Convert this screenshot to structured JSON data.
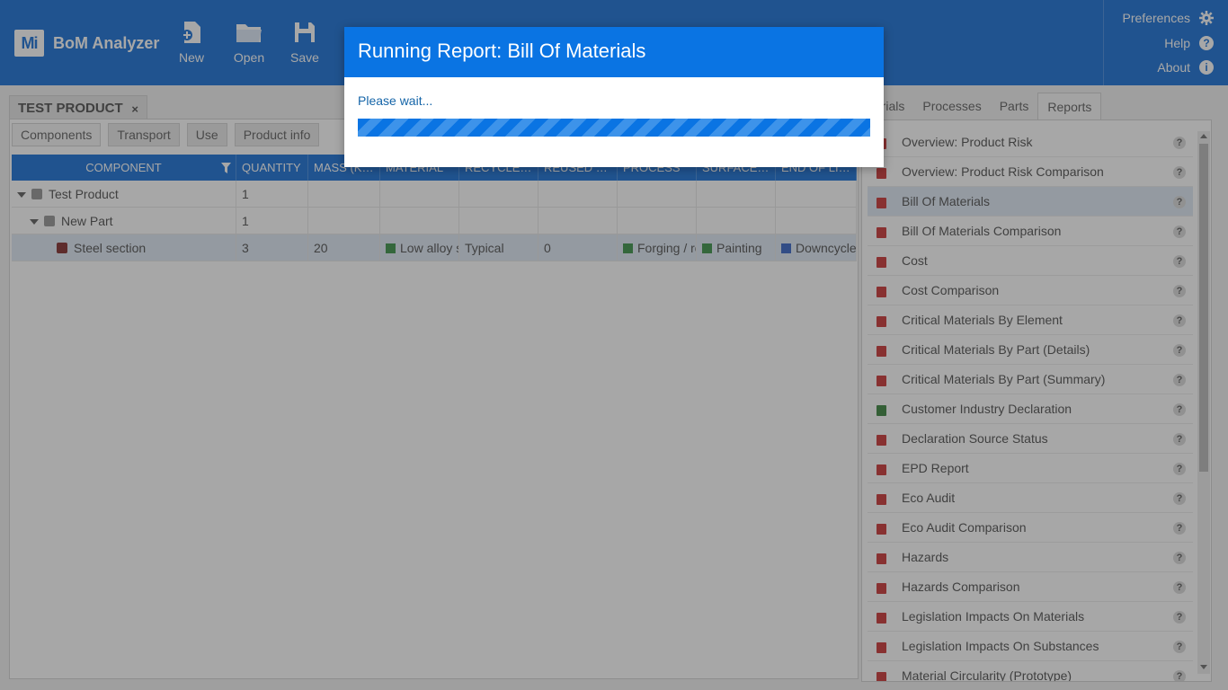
{
  "app": {
    "logo": "Mi",
    "name": "BoM Analyzer"
  },
  "toolbar": {
    "new": "New",
    "open": "Open",
    "save": "Save"
  },
  "header_menu": {
    "preferences": "Preferences",
    "help": "Help",
    "about": "About"
  },
  "product_tab": {
    "title": "TEST PRODUCT",
    "close": "×"
  },
  "subtabs": [
    "Components",
    "Transport",
    "Use",
    "Product info"
  ],
  "grid": {
    "columns": [
      "COMPONENT",
      "QUANTITY",
      "MASS (K…",
      "MATERIAL",
      "RECYCLE…",
      "REUSED …",
      "PROCESS",
      "SURFACE…",
      "END OF LI…"
    ],
    "rows": [
      {
        "component": "Test Product",
        "quantity": "1",
        "mass": "",
        "material": "",
        "recycle": "",
        "reused": "",
        "process": "",
        "surface": "",
        "eol": ""
      },
      {
        "component": "New Part",
        "quantity": "1",
        "mass": "",
        "material": "",
        "recycle": "",
        "reused": "",
        "process": "",
        "surface": "",
        "eol": ""
      },
      {
        "component": "Steel section",
        "quantity": "3",
        "mass": "20",
        "material": "Low alloy steel",
        "recycle": "Typical",
        "reused": "0",
        "process": "Forging / rolling",
        "surface": "Painting",
        "eol": "Downcycle"
      }
    ]
  },
  "right_tabs": [
    "terials",
    "Processes",
    "Parts",
    "Reports"
  ],
  "reports": [
    {
      "label": "Overview: Product Risk",
      "type": "pdf"
    },
    {
      "label": "Overview: Product Risk Comparison",
      "type": "pdf"
    },
    {
      "label": "Bill Of Materials",
      "type": "pdf"
    },
    {
      "label": "Bill Of Materials Comparison",
      "type": "pdf"
    },
    {
      "label": "Cost",
      "type": "pdf"
    },
    {
      "label": "Cost Comparison",
      "type": "pdf"
    },
    {
      "label": "Critical Materials By Element",
      "type": "pdf"
    },
    {
      "label": "Critical Materials By Part (Details)",
      "type": "pdf"
    },
    {
      "label": "Critical Materials By Part (Summary)",
      "type": "pdf"
    },
    {
      "label": "Customer Industry Declaration",
      "type": "xls"
    },
    {
      "label": "Declaration Source Status",
      "type": "pdf"
    },
    {
      "label": "EPD Report",
      "type": "pdf"
    },
    {
      "label": "Eco Audit",
      "type": "pdf"
    },
    {
      "label": "Eco Audit Comparison",
      "type": "pdf"
    },
    {
      "label": "Hazards",
      "type": "pdf"
    },
    {
      "label": "Hazards Comparison",
      "type": "pdf"
    },
    {
      "label": "Legislation Impacts On Materials",
      "type": "pdf"
    },
    {
      "label": "Legislation Impacts On Substances",
      "type": "pdf"
    },
    {
      "label": "Material Circularity (Prototype)",
      "type": "pdf"
    }
  ],
  "help_glyph": "?",
  "dialog": {
    "title": "Running Report: Bill Of Materials",
    "message": "Please wait..."
  },
  "colors": {
    "brand": "#0a67d3",
    "accent": "#0a74e3",
    "pdf_icon": "#c62828",
    "xls_icon": "#2e7d32"
  }
}
